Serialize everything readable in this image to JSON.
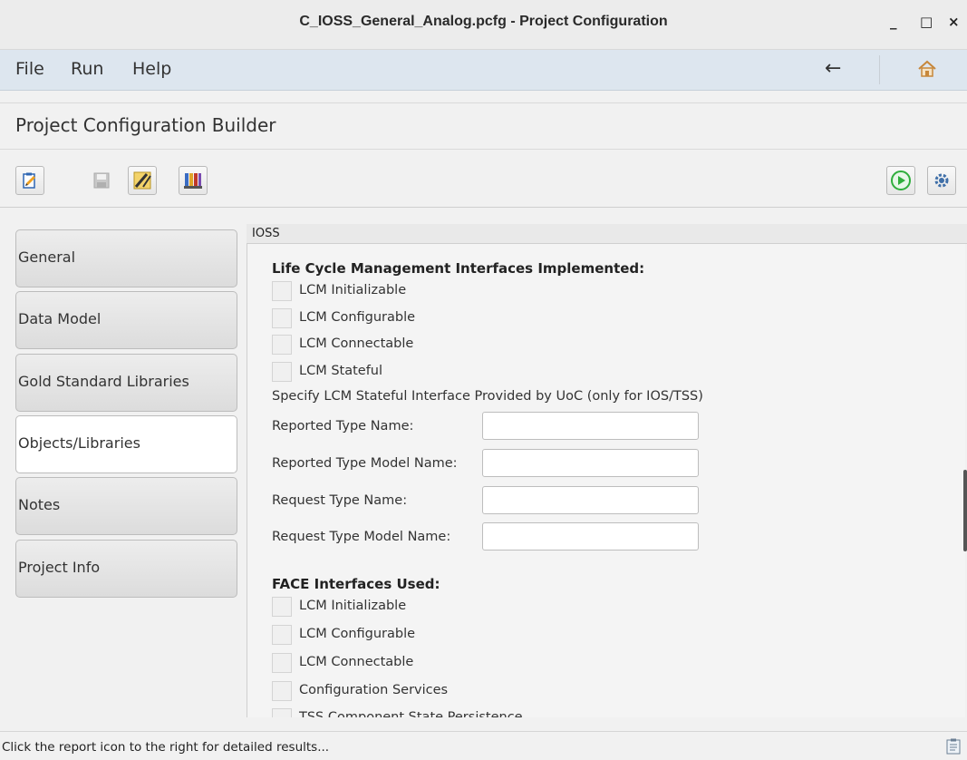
{
  "window": {
    "title": "C_IOSS_General_Analog.pcfg - Project Configuration",
    "minimize": "_",
    "maximize": "□",
    "close": "×"
  },
  "menu": {
    "items": [
      "File",
      "Run",
      "Help"
    ],
    "back_icon": "←",
    "home_icon": "home-icon"
  },
  "page": {
    "title": "Project Configuration Builder"
  },
  "toolbar": {
    "left_buttons": [
      "edit-config-icon",
      "save-icon",
      "edit-sign-icon",
      "library-icon"
    ],
    "right_buttons": [
      "run-icon",
      "settings-gear-icon"
    ],
    "colors": {
      "run": "#2fae3c",
      "gear": "#3f6fa8"
    }
  },
  "sidebar": {
    "tabs": [
      {
        "label": "General",
        "active": false
      },
      {
        "label": "Data Model",
        "active": false
      },
      {
        "label": "Gold Standard Libraries",
        "active": false
      },
      {
        "label": "Objects/Libraries",
        "active": true
      },
      {
        "label": "Notes",
        "active": false
      },
      {
        "label": "Project Info",
        "active": false
      }
    ]
  },
  "content": {
    "header": "IOSS",
    "lcm_section": {
      "title": "Life Cycle Management Interfaces Implemented:",
      "checkboxes": [
        {
          "label": "LCM Initializable",
          "checked": false
        },
        {
          "label": "LCM Configurable",
          "checked": false
        },
        {
          "label": "LCM Connectable",
          "checked": false
        },
        {
          "label": "LCM Stateful",
          "checked": false
        }
      ],
      "note": "Specify LCM Stateful Interface Provided by UoC (only for IOS/TSS)",
      "fields": [
        {
          "label": "Reported Type Name:",
          "value": ""
        },
        {
          "label": "Reported Type Model Name:",
          "value": ""
        },
        {
          "label": "Request Type Name:",
          "value": ""
        },
        {
          "label": "Request Type Model Name:",
          "value": ""
        }
      ]
    },
    "face_section": {
      "title": "FACE Interfaces Used:",
      "checkboxes": [
        {
          "label": "LCM Initializable",
          "checked": false
        },
        {
          "label": "LCM Configurable",
          "checked": false
        },
        {
          "label": "LCM Connectable",
          "checked": false
        },
        {
          "label": "Configuration Services",
          "checked": false
        },
        {
          "label": "TSS Component State Persistence",
          "checked": false
        }
      ]
    }
  },
  "status": {
    "text": "Click the report icon to the right for detailed results...",
    "report_icon": "report-icon"
  }
}
